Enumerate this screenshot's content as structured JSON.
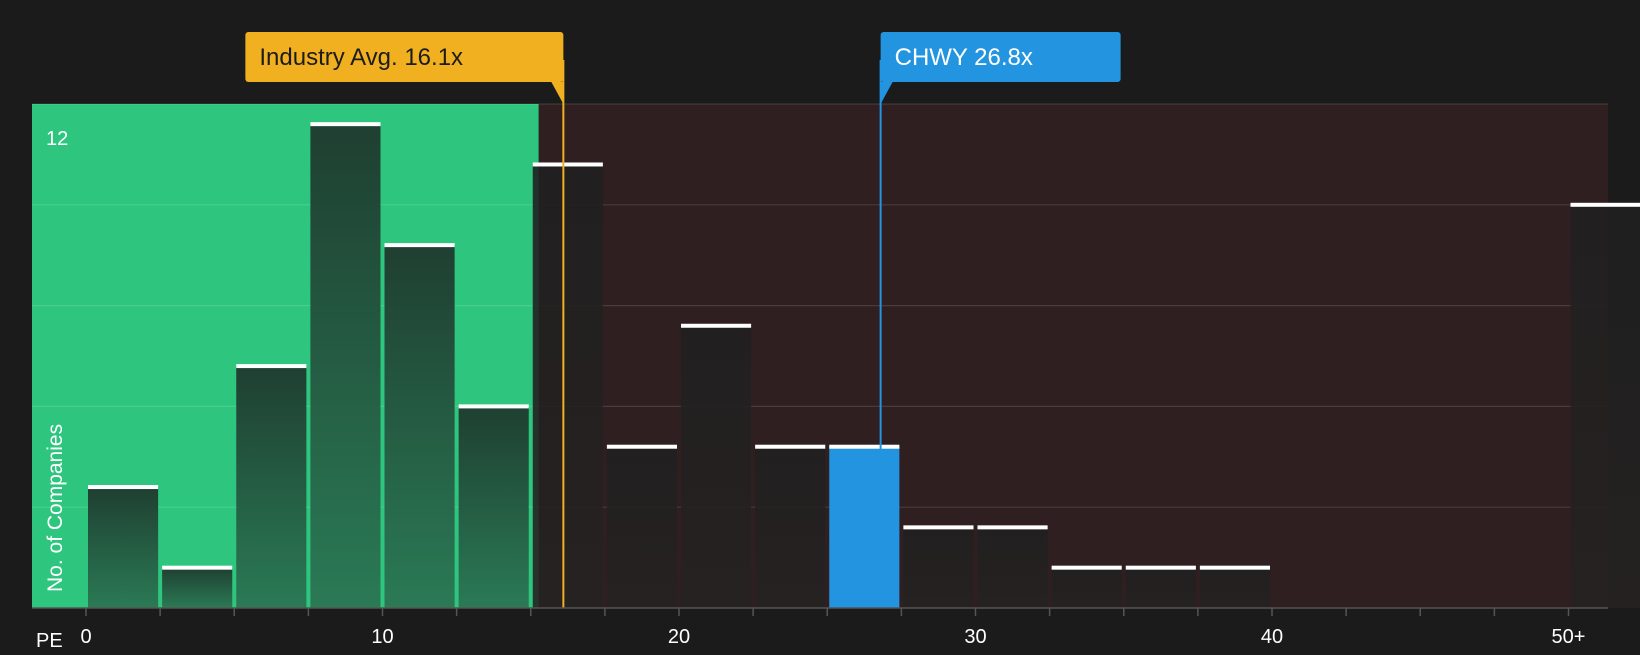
{
  "chart_data": {
    "type": "bar",
    "title": "",
    "xlabel": "PE",
    "ylabel": "No. of Companies",
    "ylim": [
      0,
      12.5
    ],
    "x_tick_labels": [
      "0",
      "10",
      "20",
      "30",
      "40",
      "50+"
    ],
    "y_tick_labels": [
      "12"
    ],
    "bin_width": 2.5,
    "bins": [
      {
        "start": 0,
        "end": 2.5,
        "value": 3
      },
      {
        "start": 2.5,
        "end": 5,
        "value": 1
      },
      {
        "start": 5,
        "end": 7.5,
        "value": 6
      },
      {
        "start": 7.5,
        "end": 10,
        "value": 12
      },
      {
        "start": 10,
        "end": 12.5,
        "value": 9
      },
      {
        "start": 12.5,
        "end": 15,
        "value": 5
      },
      {
        "start": 15,
        "end": 17.5,
        "value": 11
      },
      {
        "start": 17.5,
        "end": 20,
        "value": 4
      },
      {
        "start": 20,
        "end": 22.5,
        "value": 7
      },
      {
        "start": 22.5,
        "end": 25,
        "value": 4
      },
      {
        "start": 25,
        "end": 27.5,
        "value": 4
      },
      {
        "start": 27.5,
        "end": 30,
        "value": 2
      },
      {
        "start": 30,
        "end": 32.5,
        "value": 2
      },
      {
        "start": 32.5,
        "end": 35,
        "value": 1
      },
      {
        "start": 35,
        "end": 37.5,
        "value": 1
      },
      {
        "start": 37.5,
        "end": 40,
        "value": 1
      },
      {
        "start": 50,
        "end": 52.5,
        "value": 10
      }
    ],
    "highlight_bin_start": 25,
    "markers": [
      {
        "label": "Industry Avg. 16.1x",
        "value": 16.1,
        "color": "#f0b020"
      },
      {
        "label": "CHWY 26.8x",
        "value": 26.8,
        "color": "#2394e0"
      }
    ],
    "regions": {
      "below_avg_color": "#2ec67f",
      "above_avg_color": "#2f1f20"
    },
    "grid": true
  }
}
